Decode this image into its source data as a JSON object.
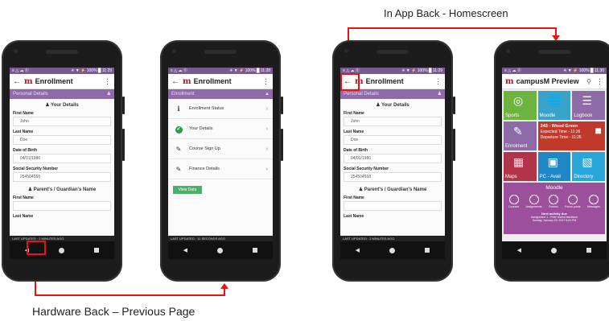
{
  "captions": {
    "top": "In App Back - Homescreen",
    "bottom": "Hardware Back – Previous Page"
  },
  "status": {
    "left": "≡ △ ☁ ⓖ",
    "right": "✳ ▼ ⚡ 100% █ 11:29",
    "right_2": "✳ ▼ ⚡ 100% █ 11:28",
    "right_4": "✳ ▼ ⚡ 100% █ 11:30"
  },
  "app": {
    "back": "←",
    "logo": "m",
    "title": "Enrollment",
    "menu": "⋮"
  },
  "phone1": {
    "section": "Personal Details",
    "your_details": "Your Details",
    "fields": [
      {
        "label": "First Name",
        "value": "John"
      },
      {
        "label": "Last Name",
        "value": "Doe"
      },
      {
        "label": "Date of Birth",
        "value": "04/01/1986"
      },
      {
        "label": "Social Security Number",
        "value": "254504568"
      }
    ],
    "guardian": "Parent's / Guardian's Name",
    "guardian_fields": [
      {
        "label": "First Name",
        "value": ""
      },
      {
        "label": "Last Name",
        "value": ""
      }
    ],
    "last_updated": "LAST UPDATED : 2 MINUTES AGO"
  },
  "phone2": {
    "section": "Enrollment",
    "items": [
      {
        "label": "Enrollment Status",
        "icon": "i"
      },
      {
        "label": "Your Details",
        "icon": "✔"
      },
      {
        "label": "Course Sign Up",
        "icon": "✎"
      },
      {
        "label": "Finance Details",
        "icon": "✎"
      }
    ],
    "button": "View Data",
    "last_updated": "LAST UPDATED : 11 SECONDS AGO"
  },
  "phone4": {
    "title": "campusM Preview",
    "tiles": [
      {
        "label": "Sports",
        "color": "#6db33f"
      },
      {
        "label": "Moodle",
        "color": "#3aa2c9"
      },
      {
        "label": "Logbook",
        "color": "#8e6aa9"
      },
      {
        "label": "Enrolment",
        "color": "#8e6aa9"
      },
      {
        "label": "243 - Wood Green",
        "color": "#c0392b"
      },
      {
        "label": "Departure Time",
        "color": "#c0392b"
      },
      {
        "label": "Maps",
        "color": "#b0344a"
      },
      {
        "label": "PC - Avail",
        "color": "#1e88c7"
      },
      {
        "label": "Directory",
        "color": "#29a6d9"
      }
    ],
    "bus_lines": [
      "243 - Wood Green",
      "Expected Time - 11:26",
      "Departure Time - 11:26"
    ],
    "moodle_title": "Moodle",
    "moodle_icons": [
      "Courses",
      "Assignments",
      "Forums",
      "Forum posts",
      "Messages"
    ],
    "moodle_footer": [
      "Next activity due",
      "Assignment 1 - Peer review feedback",
      "Sunday, January 29, 2017 6:00 PM"
    ]
  },
  "nav": {
    "back": "◀"
  },
  "colors": {
    "purple": "#8e6aa9",
    "red": "#e11111"
  }
}
